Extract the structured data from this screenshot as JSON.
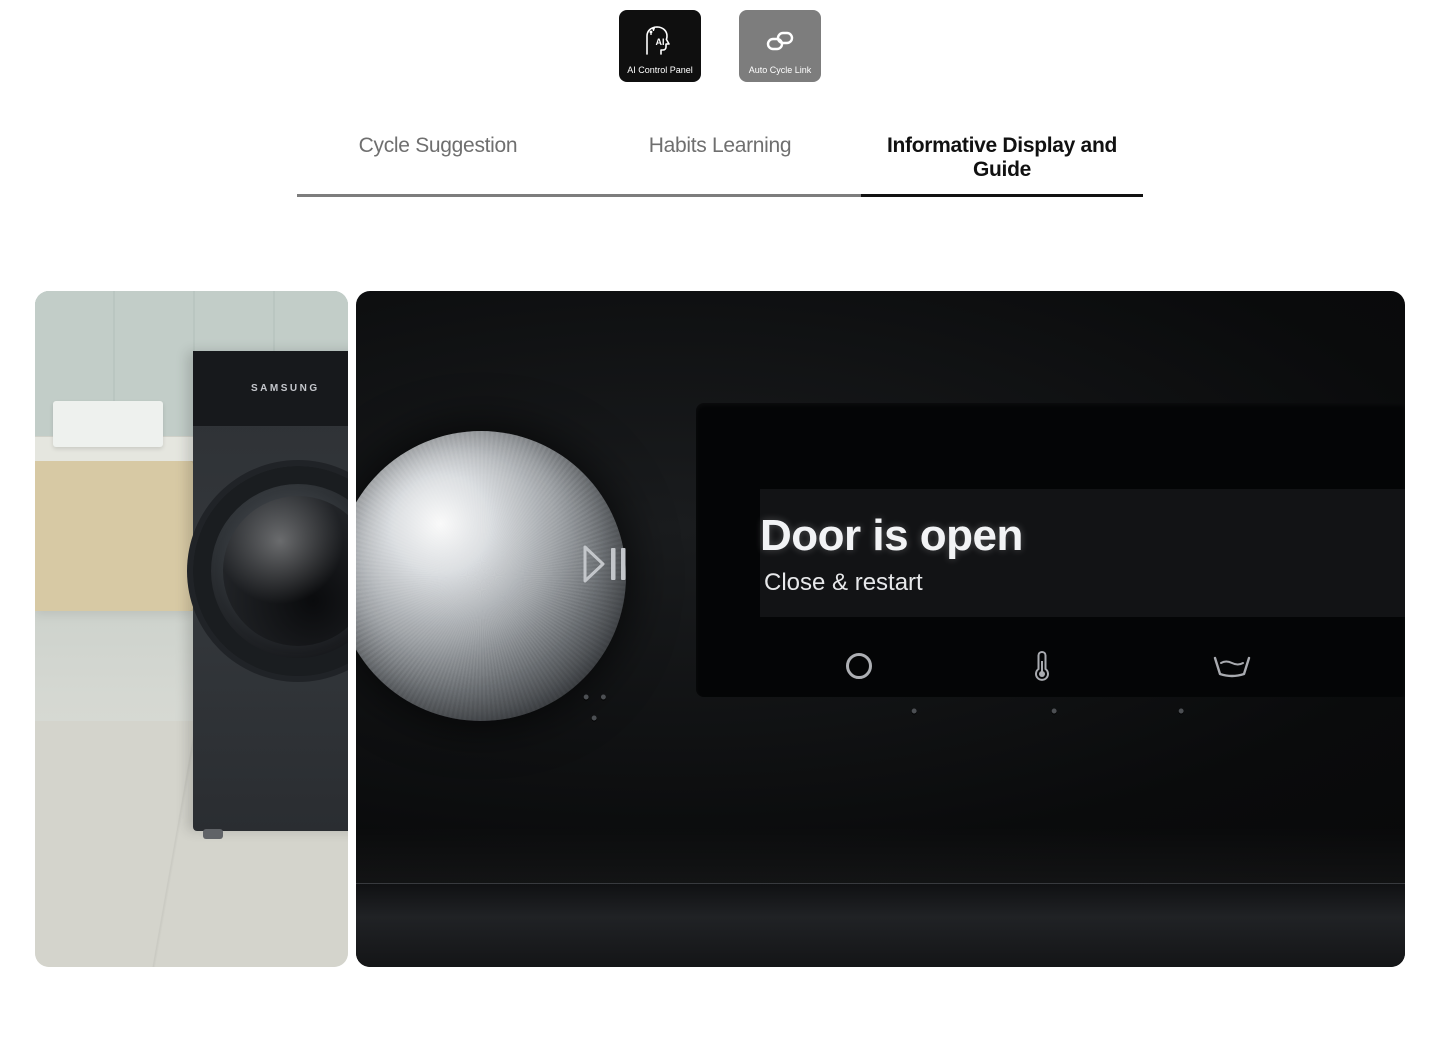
{
  "badges": [
    {
      "label": "AI Control Panel"
    },
    {
      "label": "Auto Cycle Link"
    }
  ],
  "tabs": [
    {
      "label": "Cycle Suggestion",
      "active": false
    },
    {
      "label": "Habits Learning",
      "active": false
    },
    {
      "label": "Informative Display and Guide",
      "active": true
    }
  ],
  "washer_brand": "SAMSUNG",
  "display": {
    "title": "Door is open",
    "subtitle": "Close & restart"
  }
}
